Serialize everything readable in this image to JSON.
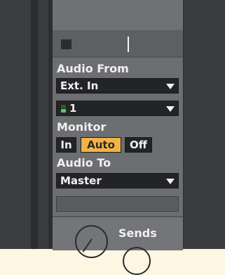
{
  "audio_from": {
    "label": "Audio From",
    "type_value": "Ext. In",
    "channel_value": "1"
  },
  "monitor": {
    "label": "Monitor",
    "options": [
      "In",
      "Auto",
      "Off"
    ],
    "selected": "Auto"
  },
  "audio_to": {
    "label": "Audio To",
    "value": "Master"
  },
  "sends": {
    "label": "Sends"
  },
  "colors": {
    "active_accent": "#f3b445",
    "meter_signal": "#48d64a",
    "panel_bg": "#6d6e71",
    "field_bg": "#232426"
  }
}
